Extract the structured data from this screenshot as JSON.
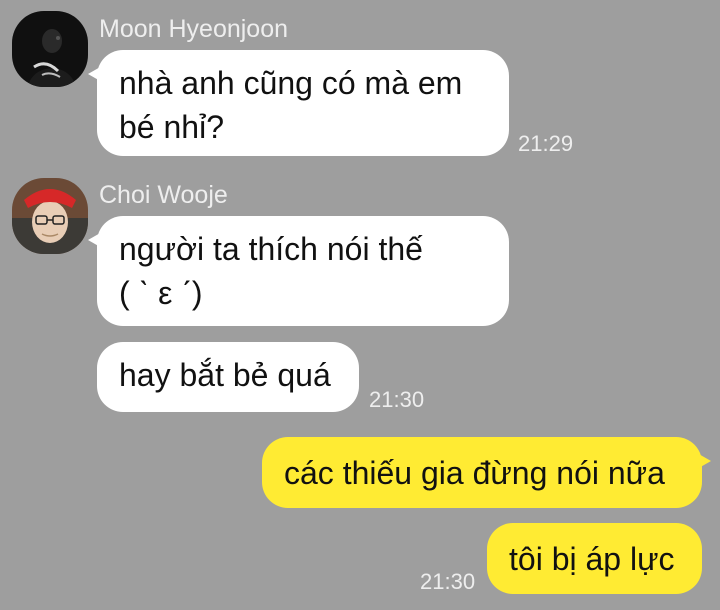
{
  "colors": {
    "background": "#9e9e9e",
    "incoming_bubble": "#ffffff",
    "outgoing_bubble": "#ffeb33",
    "meta_text": "#eeeeee"
  },
  "messages": [
    {
      "sender": "Moon Hyeonjoon",
      "avatar": "profile-photo",
      "direction": "incoming",
      "lines": [
        "nhà anh cũng có mà em",
        "bé nhỉ?"
      ],
      "time": "21:29"
    },
    {
      "sender": "Choi Wooje",
      "avatar": "profile-photo",
      "direction": "incoming",
      "lines": [
        "người ta thích nói thế",
        "( ˋ ε ˊ)"
      ],
      "time": ""
    },
    {
      "sender": "Choi Wooje",
      "direction": "incoming",
      "lines": [
        "hay bắt bẻ quá"
      ],
      "time": "21:30"
    },
    {
      "direction": "outgoing",
      "lines": [
        "các thiếu gia đừng nói nữa"
      ],
      "time": ""
    },
    {
      "direction": "outgoing",
      "lines": [
        "tôi bị áp lực"
      ],
      "time": "21:30"
    }
  ]
}
